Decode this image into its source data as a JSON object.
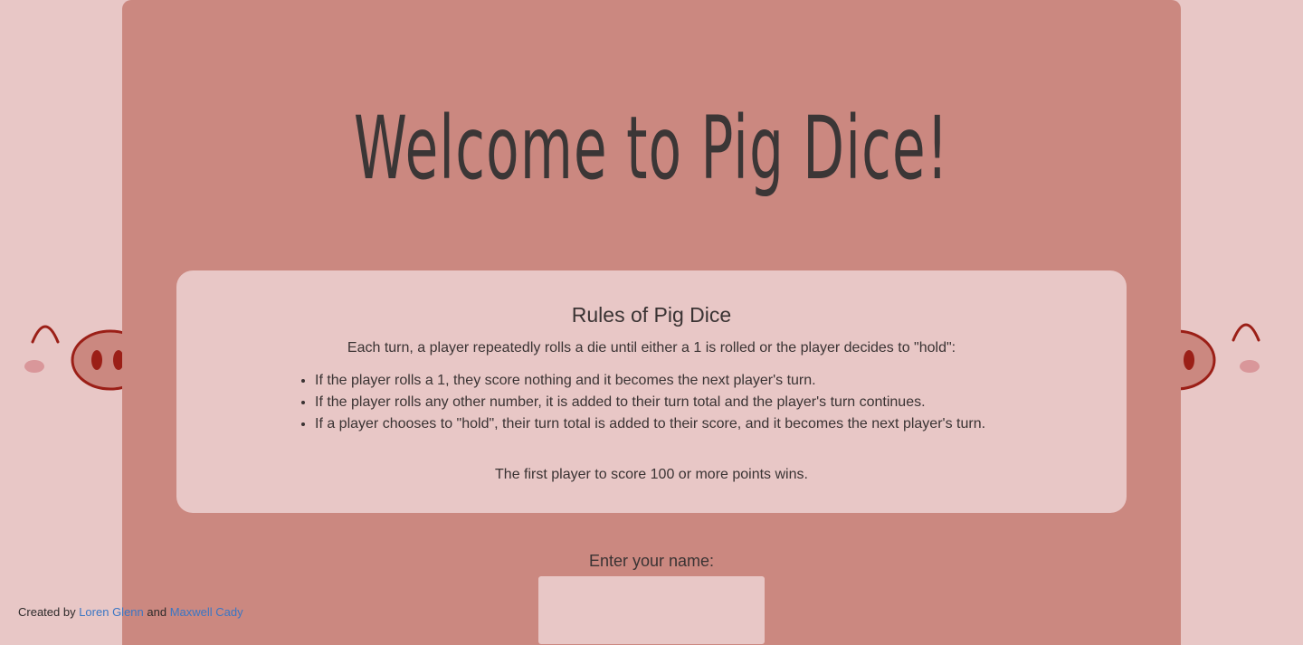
{
  "header": {
    "title": "Welcome to Pig Dice!"
  },
  "rules": {
    "heading": "Rules of Pig Dice",
    "intro": "Each turn, a player repeatedly rolls a die until either a 1 is rolled or the player decides to \"hold\":",
    "items": [
      "If the player rolls a 1, they score nothing and it becomes the next player's turn.",
      "If the player rolls any other number, it is added to their turn total and the player's turn continues.",
      "If a player chooses to \"hold\", their turn total is added to their score, and it becomes the next player's turn."
    ],
    "outro": "The first player to score 100 or more points wins."
  },
  "name_form": {
    "label": "Enter your name:",
    "value": "",
    "placeholder": ""
  },
  "footer": {
    "prefix": "Created by ",
    "author1": "Loren Glenn",
    "conjunction": " and ",
    "author2": "Maxwell Cady"
  },
  "colors": {
    "background": "#e8c7c6",
    "panel": "#cb8880",
    "pig_dark": "#9b1f17",
    "link": "#3a76c4"
  }
}
